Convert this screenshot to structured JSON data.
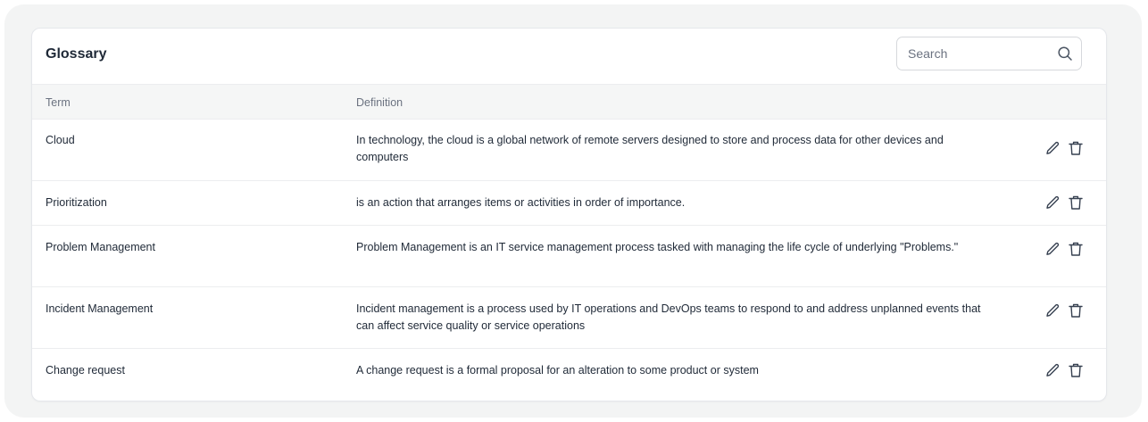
{
  "glossary": {
    "title": "Glossary",
    "search": {
      "placeholder": "Search",
      "value": "",
      "icon": "search-icon"
    },
    "columns": {
      "term": "Term",
      "definition": "Definition"
    },
    "rows": [
      {
        "term": "Cloud",
        "definition": "In technology, the cloud is a global network of remote servers designed to store and process data for other devices and computers"
      },
      {
        "term": "Prioritization",
        "definition": "is an action that arranges items or activities in order of importance."
      },
      {
        "term": "Problem Management",
        "definition": "Problem Management is an IT service management process tasked with managing the life cycle of underlying \"Problems.\""
      },
      {
        "term": "Incident Management",
        "definition": "Incident management is a process used by IT operations and DevOps teams to respond to and address unplanned events that can affect service quality or service operations"
      },
      {
        "term": "Change request",
        "definition": "A change request is a formal proposal for an alteration to some product or system"
      }
    ],
    "row_actions": {
      "edit_icon": "pencil-icon",
      "delete_icon": "trash-icon"
    },
    "colors": {
      "background": "#f3f4f4",
      "card": "#ffffff",
      "header_row": "#f5f6f6",
      "border": "#ecedef",
      "text": "#1f2937",
      "muted": "#6b7280"
    }
  }
}
